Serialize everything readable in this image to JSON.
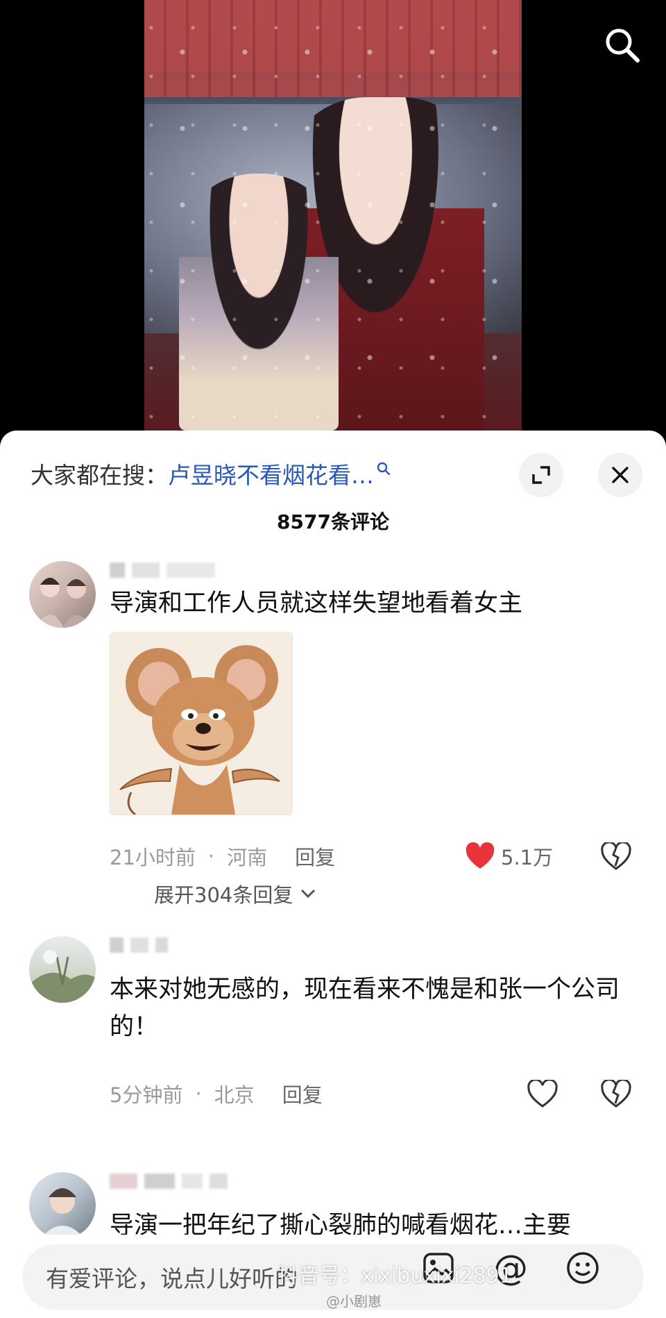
{
  "search_icon": "search-icon",
  "trending": {
    "prefix": "大家都在搜：",
    "query": "卢昱晓不看烟花看…"
  },
  "comment_count": "8577条评论",
  "comments": [
    {
      "text": "导演和工作人员就这样失望地看着女主",
      "sticker": "jerry-mouse-sticker",
      "time": "21小时前",
      "location": "河南",
      "reply_label": "回复",
      "likes": "5.1万",
      "liked": true,
      "expand_replies": "展开304条回复"
    },
    {
      "text": "本来对她无感的，现在看来不愧是和张一个公司的！",
      "time": "5分钟前",
      "location": "北京",
      "reply_label": "回复",
      "liked": false
    },
    {
      "text": "导演一把年纪了撕心裂肺的喊看烟花…主要"
    }
  ],
  "separator": "·",
  "input": {
    "placeholder": "有爱评论，说点儿好听的",
    "mention_symbol": "@"
  },
  "watermark": {
    "main": "抖音号：xixibuxixi2891",
    "sub": "@小剧崽"
  },
  "colors": {
    "link": "#2a58b8",
    "like_red": "#e8323c",
    "muted": "#9a9a9a"
  }
}
